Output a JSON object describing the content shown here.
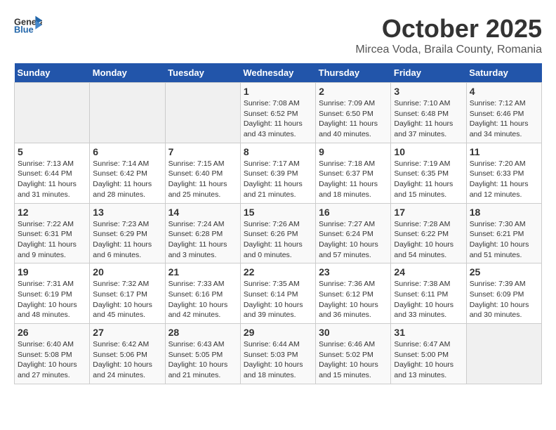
{
  "header": {
    "logo_general": "General",
    "logo_blue": "Blue",
    "title": "October 2025",
    "subtitle": "Mircea Voda, Braila County, Romania"
  },
  "weekdays": [
    "Sunday",
    "Monday",
    "Tuesday",
    "Wednesday",
    "Thursday",
    "Friday",
    "Saturday"
  ],
  "weeks": [
    [
      {
        "day": "",
        "info": ""
      },
      {
        "day": "",
        "info": ""
      },
      {
        "day": "",
        "info": ""
      },
      {
        "day": "1",
        "info": "Sunrise: 7:08 AM\nSunset: 6:52 PM\nDaylight: 11 hours\nand 43 minutes."
      },
      {
        "day": "2",
        "info": "Sunrise: 7:09 AM\nSunset: 6:50 PM\nDaylight: 11 hours\nand 40 minutes."
      },
      {
        "day": "3",
        "info": "Sunrise: 7:10 AM\nSunset: 6:48 PM\nDaylight: 11 hours\nand 37 minutes."
      },
      {
        "day": "4",
        "info": "Sunrise: 7:12 AM\nSunset: 6:46 PM\nDaylight: 11 hours\nand 34 minutes."
      }
    ],
    [
      {
        "day": "5",
        "info": "Sunrise: 7:13 AM\nSunset: 6:44 PM\nDaylight: 11 hours\nand 31 minutes."
      },
      {
        "day": "6",
        "info": "Sunrise: 7:14 AM\nSunset: 6:42 PM\nDaylight: 11 hours\nand 28 minutes."
      },
      {
        "day": "7",
        "info": "Sunrise: 7:15 AM\nSunset: 6:40 PM\nDaylight: 11 hours\nand 25 minutes."
      },
      {
        "day": "8",
        "info": "Sunrise: 7:17 AM\nSunset: 6:39 PM\nDaylight: 11 hours\nand 21 minutes."
      },
      {
        "day": "9",
        "info": "Sunrise: 7:18 AM\nSunset: 6:37 PM\nDaylight: 11 hours\nand 18 minutes."
      },
      {
        "day": "10",
        "info": "Sunrise: 7:19 AM\nSunset: 6:35 PM\nDaylight: 11 hours\nand 15 minutes."
      },
      {
        "day": "11",
        "info": "Sunrise: 7:20 AM\nSunset: 6:33 PM\nDaylight: 11 hours\nand 12 minutes."
      }
    ],
    [
      {
        "day": "12",
        "info": "Sunrise: 7:22 AM\nSunset: 6:31 PM\nDaylight: 11 hours\nand 9 minutes."
      },
      {
        "day": "13",
        "info": "Sunrise: 7:23 AM\nSunset: 6:29 PM\nDaylight: 11 hours\nand 6 minutes."
      },
      {
        "day": "14",
        "info": "Sunrise: 7:24 AM\nSunset: 6:28 PM\nDaylight: 11 hours\nand 3 minutes."
      },
      {
        "day": "15",
        "info": "Sunrise: 7:26 AM\nSunset: 6:26 PM\nDaylight: 11 hours\nand 0 minutes."
      },
      {
        "day": "16",
        "info": "Sunrise: 7:27 AM\nSunset: 6:24 PM\nDaylight: 10 hours\nand 57 minutes."
      },
      {
        "day": "17",
        "info": "Sunrise: 7:28 AM\nSunset: 6:22 PM\nDaylight: 10 hours\nand 54 minutes."
      },
      {
        "day": "18",
        "info": "Sunrise: 7:30 AM\nSunset: 6:21 PM\nDaylight: 10 hours\nand 51 minutes."
      }
    ],
    [
      {
        "day": "19",
        "info": "Sunrise: 7:31 AM\nSunset: 6:19 PM\nDaylight: 10 hours\nand 48 minutes."
      },
      {
        "day": "20",
        "info": "Sunrise: 7:32 AM\nSunset: 6:17 PM\nDaylight: 10 hours\nand 45 minutes."
      },
      {
        "day": "21",
        "info": "Sunrise: 7:33 AM\nSunset: 6:16 PM\nDaylight: 10 hours\nand 42 minutes."
      },
      {
        "day": "22",
        "info": "Sunrise: 7:35 AM\nSunset: 6:14 PM\nDaylight: 10 hours\nand 39 minutes."
      },
      {
        "day": "23",
        "info": "Sunrise: 7:36 AM\nSunset: 6:12 PM\nDaylight: 10 hours\nand 36 minutes."
      },
      {
        "day": "24",
        "info": "Sunrise: 7:38 AM\nSunset: 6:11 PM\nDaylight: 10 hours\nand 33 minutes."
      },
      {
        "day": "25",
        "info": "Sunrise: 7:39 AM\nSunset: 6:09 PM\nDaylight: 10 hours\nand 30 minutes."
      }
    ],
    [
      {
        "day": "26",
        "info": "Sunrise: 6:40 AM\nSunset: 5:08 PM\nDaylight: 10 hours\nand 27 minutes."
      },
      {
        "day": "27",
        "info": "Sunrise: 6:42 AM\nSunset: 5:06 PM\nDaylight: 10 hours\nand 24 minutes."
      },
      {
        "day": "28",
        "info": "Sunrise: 6:43 AM\nSunset: 5:05 PM\nDaylight: 10 hours\nand 21 minutes."
      },
      {
        "day": "29",
        "info": "Sunrise: 6:44 AM\nSunset: 5:03 PM\nDaylight: 10 hours\nand 18 minutes."
      },
      {
        "day": "30",
        "info": "Sunrise: 6:46 AM\nSunset: 5:02 PM\nDaylight: 10 hours\nand 15 minutes."
      },
      {
        "day": "31",
        "info": "Sunrise: 6:47 AM\nSunset: 5:00 PM\nDaylight: 10 hours\nand 13 minutes."
      },
      {
        "day": "",
        "info": ""
      }
    ]
  ]
}
